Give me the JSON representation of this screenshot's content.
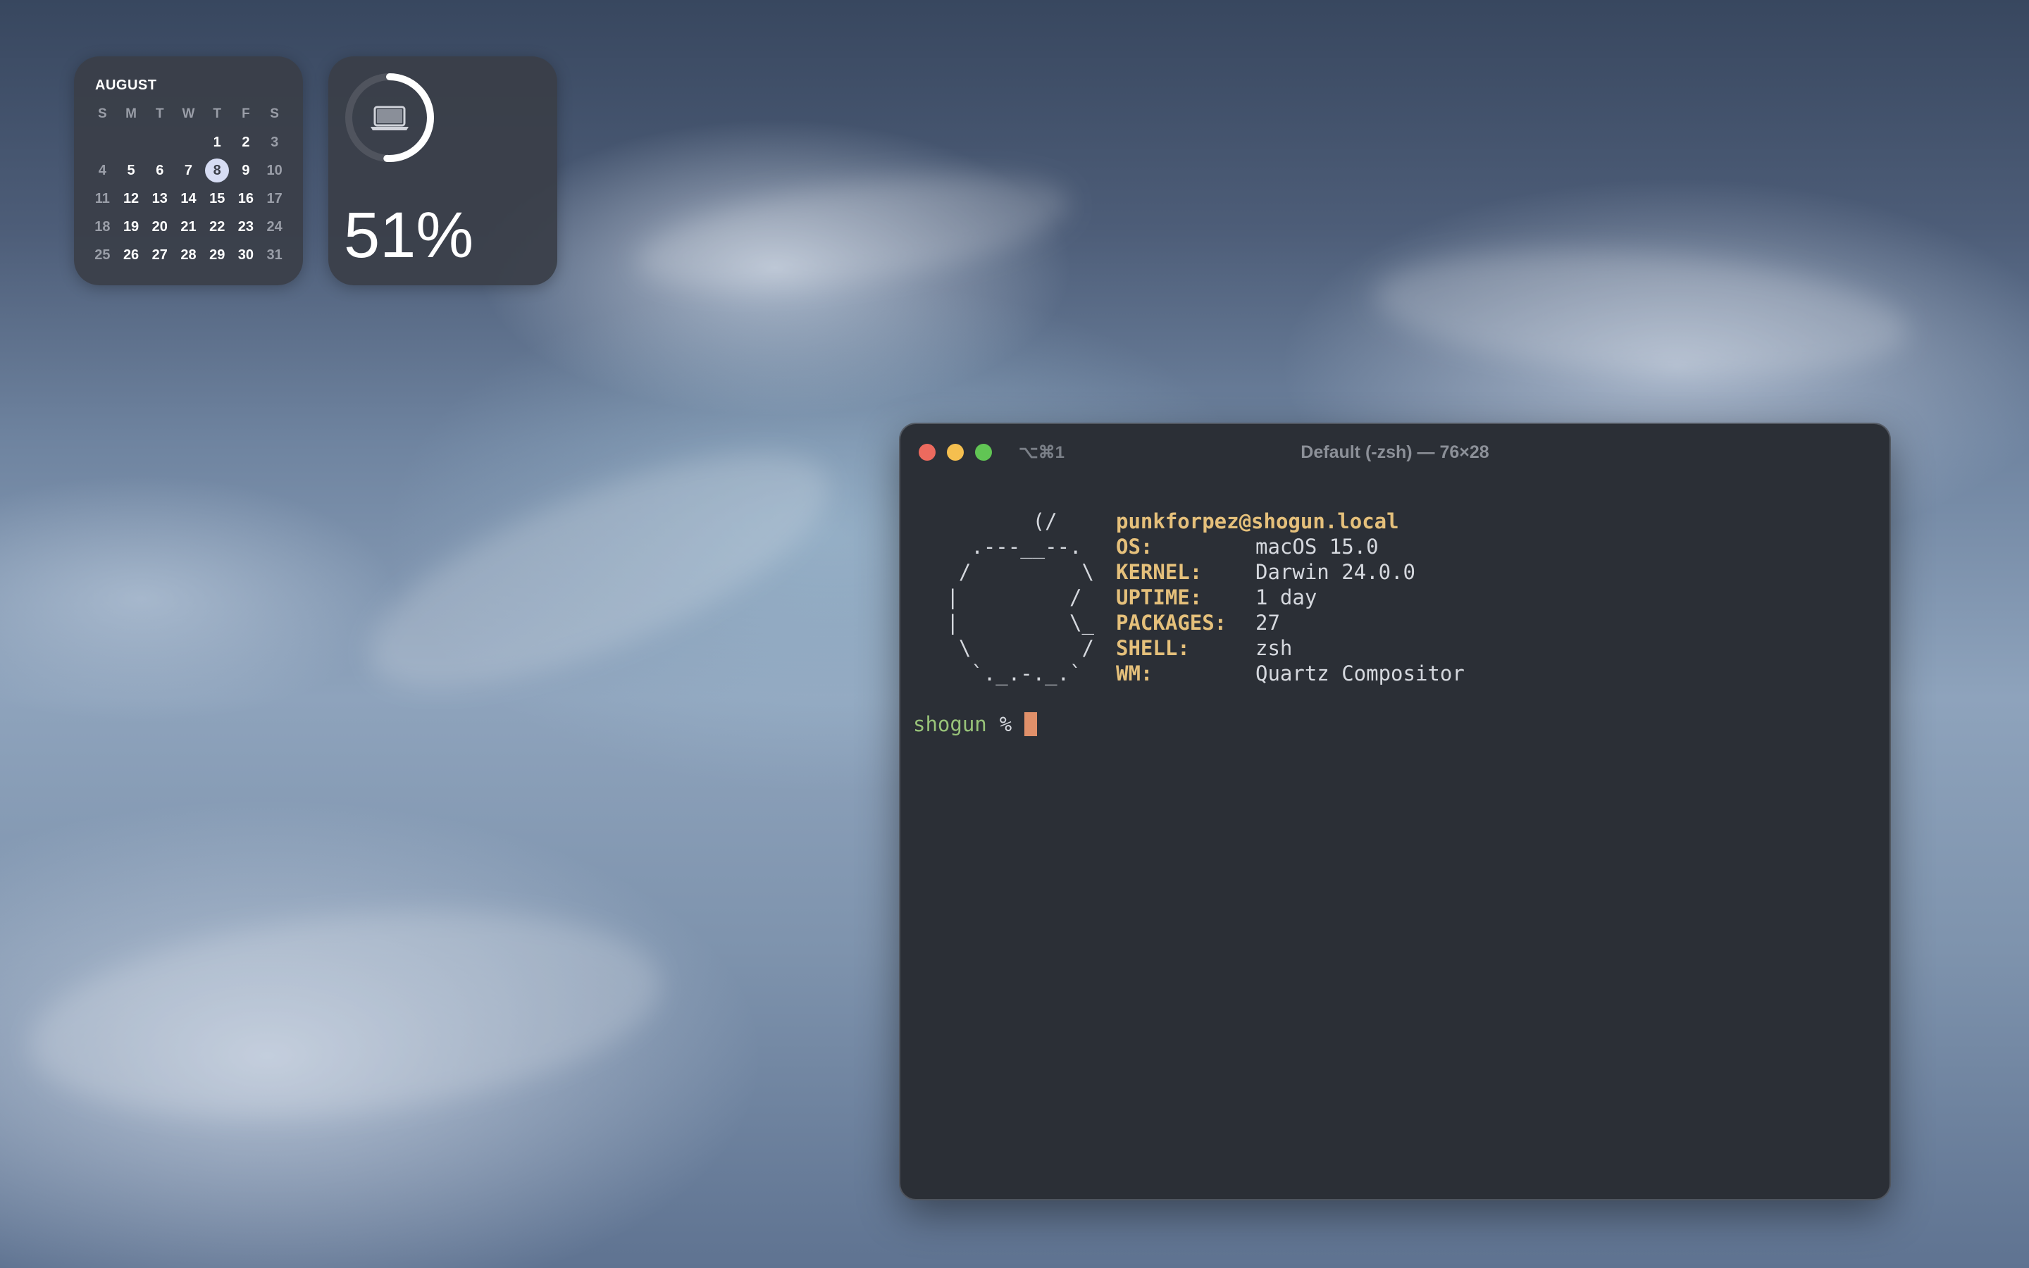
{
  "widgets": {
    "calendar": {
      "month": "AUGUST",
      "weekdays": [
        "S",
        "M",
        "T",
        "W",
        "T",
        "F",
        "S"
      ],
      "weeks": [
        [
          "",
          "",
          "",
          "",
          "1",
          "2",
          "3"
        ],
        [
          "4",
          "5",
          "6",
          "7",
          "8",
          "9",
          "10"
        ],
        [
          "11",
          "12",
          "13",
          "14",
          "15",
          "16",
          "17"
        ],
        [
          "18",
          "19",
          "20",
          "21",
          "22",
          "23",
          "24"
        ],
        [
          "25",
          "26",
          "27",
          "28",
          "29",
          "30",
          "31"
        ]
      ],
      "today": "8"
    },
    "battery": {
      "icon": "laptop-icon",
      "level": 0.51,
      "percent_label": "51%"
    }
  },
  "terminal": {
    "shortcut": "⌥⌘1",
    "title": "Default (-zsh) — 76×28",
    "ascii_art": [
      "        (/",
      "   .---__--.",
      "  /         \\",
      " |         /",
      " |         \\_",
      "  \\         /",
      "   `._.-._.`"
    ],
    "userhost": "punkforpez@shogun.local",
    "info": [
      {
        "label": "OS:",
        "value": "macOS 15.0"
      },
      {
        "label": "KERNEL:",
        "value": "Darwin 24.0.0"
      },
      {
        "label": "UPTIME:",
        "value": "1 day"
      },
      {
        "label": "PACKAGES:",
        "value": "27"
      },
      {
        "label": "SHELL:",
        "value": "zsh"
      },
      {
        "label": "WM:",
        "value": "Quartz Compositor"
      }
    ],
    "prompt": {
      "host": "shogun",
      "symbol": "%"
    }
  },
  "colors": {
    "terminal_bg": "#2b2f36",
    "label_yellow": "#e5c07b",
    "prompt_green": "#98c379",
    "cursor": "#e0906a",
    "close": "#ed6a5e",
    "minimize": "#f5bf4f",
    "zoom": "#61c554"
  }
}
